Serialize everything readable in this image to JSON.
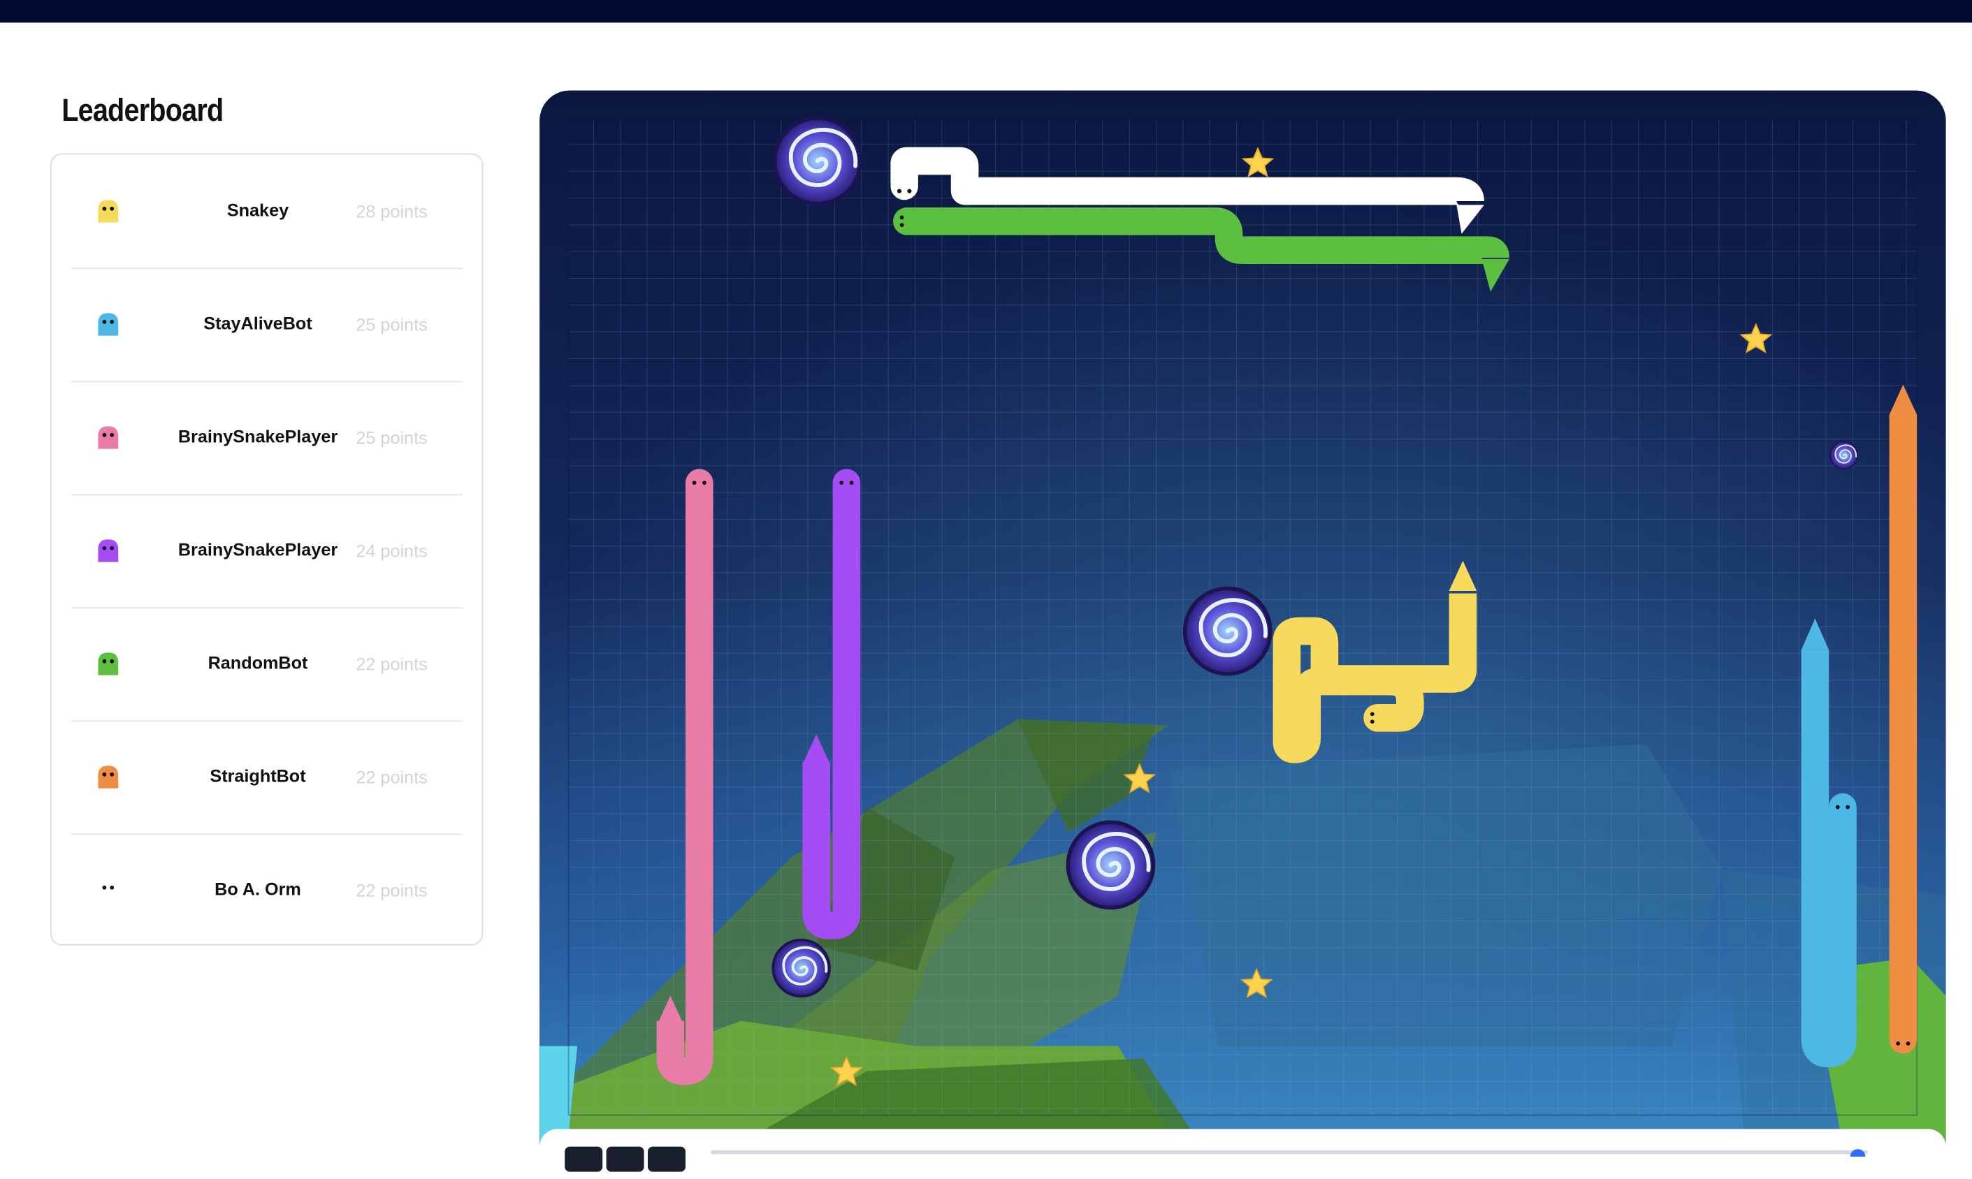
{
  "leaderboard": {
    "title": "Leaderboard",
    "entries": [
      {
        "name": "Snakey",
        "points": "28 points",
        "color": "#f7d95c"
      },
      {
        "name": "StayAliveBot",
        "points": "25 points",
        "color": "#4db7e6"
      },
      {
        "name": "BrainySnakePlayer",
        "points": "25 points",
        "color": "#e97ba7"
      },
      {
        "name": "BrainySnakePlayer",
        "points": "24 points",
        "color": "#a64cf4"
      },
      {
        "name": "RandomBot",
        "points": "22 points",
        "color": "#5cbf3f"
      },
      {
        "name": "StraightBot",
        "points": "22 points",
        "color": "#ef8d43"
      },
      {
        "name": "Bo A. Orm",
        "points": "22 points",
        "color": "#ffffff"
      }
    ]
  },
  "game": {
    "board_color": "#13275a",
    "snakes": [
      {
        "owner": "Bo A. Orm",
        "color": "#ffffff"
      },
      {
        "owner": "RandomBot",
        "color": "#5cbf3f"
      },
      {
        "owner": "BrainySnakePlayer",
        "color": "#e97ba7"
      },
      {
        "owner": "BrainySnakePlayer",
        "color": "#a64cf4"
      },
      {
        "owner": "Snakey",
        "color": "#f7d95c"
      },
      {
        "owner": "StayAliveBot",
        "color": "#4db7e6"
      },
      {
        "owner": "StraightBot",
        "color": "#ef8d43"
      }
    ],
    "items": [
      "star-icon",
      "portal-icon"
    ]
  }
}
